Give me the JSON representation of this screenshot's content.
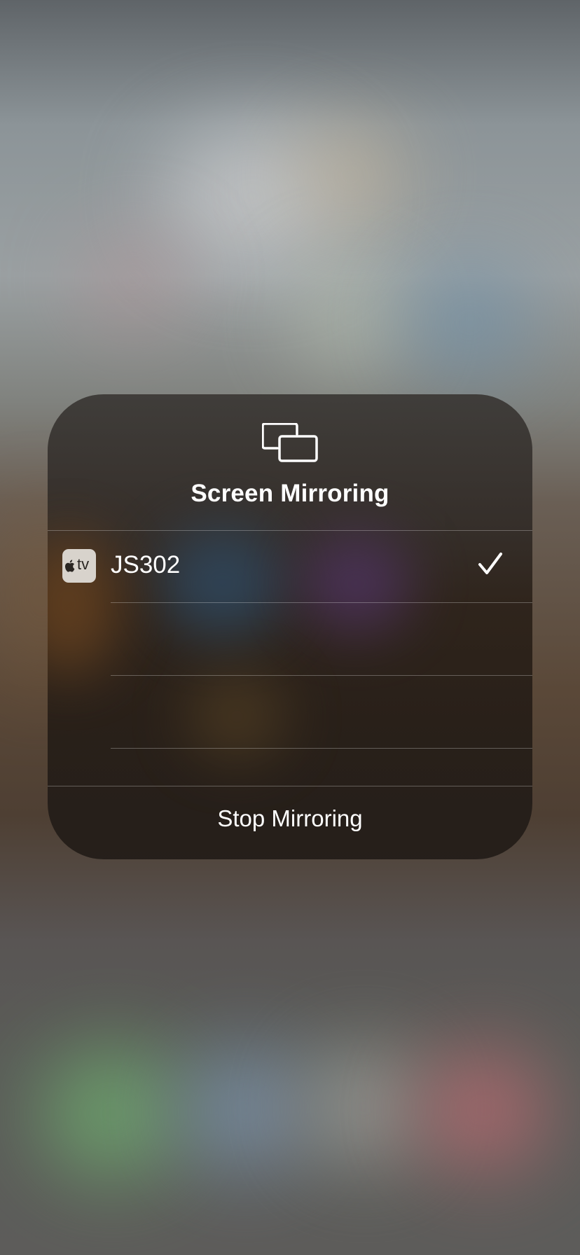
{
  "panel": {
    "title": "Screen Mirroring",
    "icon": "screen-mirroring-icon",
    "devices": [
      {
        "name": "JS302",
        "badge_icon": "apple-tv-icon",
        "badge_text": "tv",
        "selected": true
      },
      {
        "name": "",
        "selected": false
      },
      {
        "name": "",
        "selected": false
      }
    ],
    "stop_label": "Stop Mirroring"
  },
  "colors": {
    "text": "#ffffff",
    "badge_bg": "#d8d3cc",
    "badge_fg": "#2a2622"
  }
}
